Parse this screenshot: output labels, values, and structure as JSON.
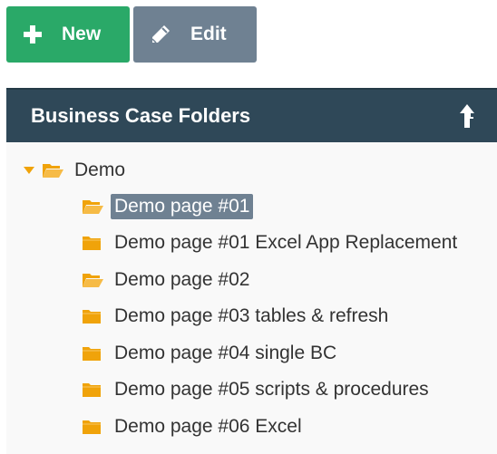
{
  "toolbar": {
    "new_label": "New",
    "edit_label": "Edit",
    "new_icon": "plus-icon",
    "edit_icon": "pencil-icon"
  },
  "panel": {
    "title": "Business Case Folders",
    "header_icon": "upload-arrow-icon",
    "root": {
      "label": "Demo",
      "expanded": true
    },
    "children": [
      {
        "label": "Demo page #01",
        "selected": true,
        "open": true
      },
      {
        "label": "Demo page #01 Excel App Replacement",
        "selected": false,
        "open": false
      },
      {
        "label": "Demo page #02",
        "selected": false,
        "open": true
      },
      {
        "label": "Demo page #03 tables & refresh",
        "selected": false,
        "open": false
      },
      {
        "label": "Demo page #04 single BC",
        "selected": false,
        "open": false
      },
      {
        "label": "Demo page #05 scripts & procedures",
        "selected": false,
        "open": false
      },
      {
        "label": "Demo page #06 Excel",
        "selected": false,
        "open": false
      }
    ]
  },
  "colors": {
    "new_button": "#2aa968",
    "edit_button": "#6f8192",
    "header_bg": "#2f4858",
    "folder": "#f0a30a",
    "selection": "#6f8192"
  }
}
